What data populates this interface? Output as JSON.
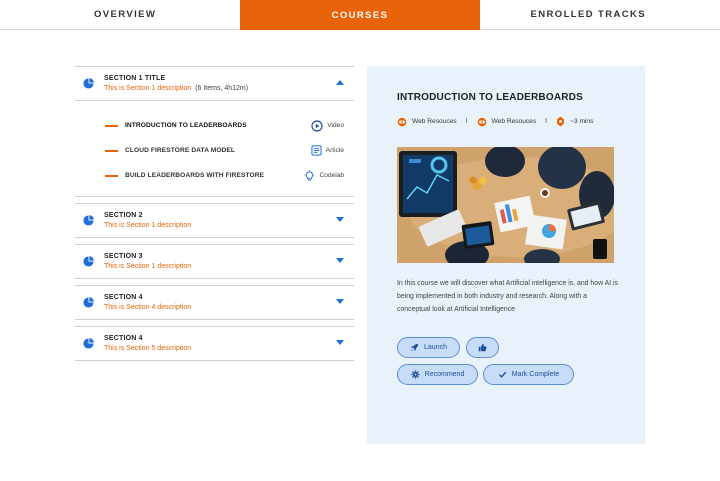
{
  "tabs": [
    {
      "label": "OVERVIEW",
      "active": false
    },
    {
      "label": "COURSES",
      "active": true
    },
    {
      "label": "ENROLLED TRACKS",
      "active": false
    }
  ],
  "sections": [
    {
      "title": "SECTION 1 TITLE",
      "description": "This is Section 1 description",
      "meta": "(6 Items, 4h12m)",
      "expanded": true,
      "items": [
        {
          "label": "INTRODUCTION TO LEADERBOARDS",
          "type": "Video",
          "icon": "play-circle-icon"
        },
        {
          "label": "CLOUD FIRESTORE DATA MODEL",
          "type": "Article",
          "icon": "article-icon"
        },
        {
          "label": "BUILD LEADERBOARDS WITH FIRESTORE",
          "type": "Codelab",
          "icon": "lightbulb-icon"
        }
      ]
    },
    {
      "title": "SECTION 2",
      "description": "This is Section 1 description",
      "expanded": false
    },
    {
      "title": "SECTION 3",
      "description": "This is Section 1 description",
      "expanded": false
    },
    {
      "title": "SECTION 4",
      "description": "This is Section 4 description",
      "expanded": false
    },
    {
      "title": "SECTION 4",
      "description": "This is Section 5 description",
      "expanded": false
    }
  ],
  "detail": {
    "title": "INTRODUCTION TO LEADERBOARDS",
    "meta": [
      {
        "icon": "web-resource-icon",
        "label": "Web Resouces"
      },
      {
        "icon": "web-resource-icon",
        "label": "Web Resouces"
      },
      {
        "icon": "timer-icon",
        "label": "~3 mins"
      }
    ],
    "separator": "I",
    "description": "In this course we will discover what Artificial intelligence is, and how AI is being implemented in both industry and research. Along with a conceptual look at Artificial Intelligence",
    "buttons": {
      "launch": "Launch",
      "recommend": "Recommend",
      "mark_complete": "Mark Complete"
    }
  },
  "colors": {
    "accent": "#e8630a",
    "link_blue": "#1e6fd9",
    "panel_bg": "#e9f1fb",
    "button_bg": "#c7dcf7"
  }
}
